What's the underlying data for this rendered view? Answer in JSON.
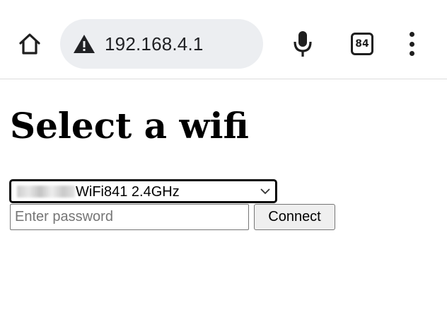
{
  "browser": {
    "url": "192.168.4.1",
    "tab_count": "84"
  },
  "page": {
    "title": "Select a wifi",
    "network_select": {
      "selected": "WiFi841 2.4GHz"
    },
    "password": {
      "value": "",
      "placeholder": "Enter password"
    },
    "connect_label": "Connect"
  },
  "icons": {
    "home": "home-icon",
    "security_warning": "warning-icon",
    "mic": "mic-icon",
    "tabs": "tab-switcher-icon",
    "menu": "more-vert-icon",
    "select_arrow": "chevron-down-icon"
  },
  "colors": {
    "omnibox_bg": "#eceef1",
    "icon": "#1f1f1f",
    "button_bg": "#efefef"
  }
}
